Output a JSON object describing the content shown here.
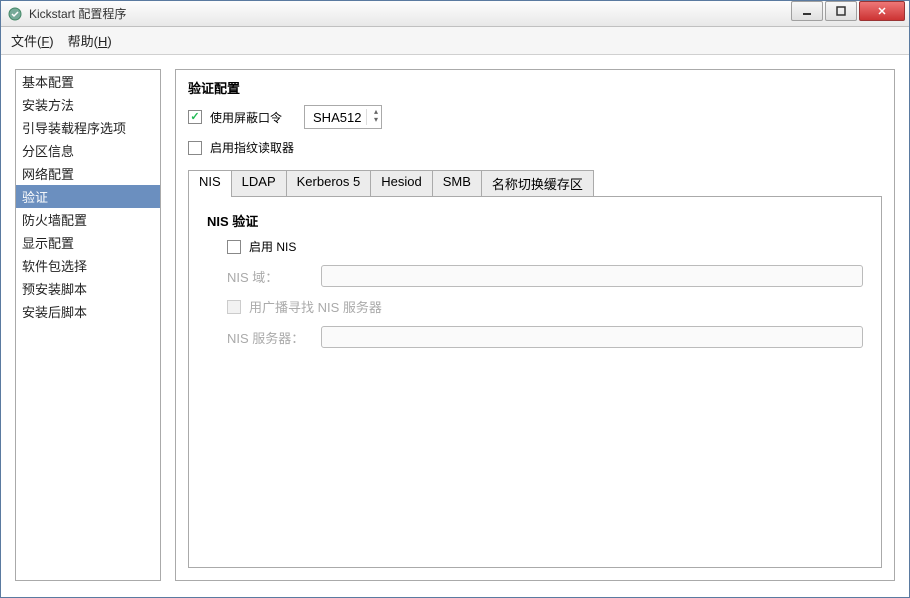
{
  "title": "Kickstart 配置程序",
  "menu": {
    "file": "文件(F)",
    "help": "帮助(H)"
  },
  "sidebar": {
    "items": [
      "基本配置",
      "安装方法",
      "引导装载程序选项",
      "分区信息",
      "网络配置",
      "验证",
      "防火墙配置",
      "显示配置",
      "软件包选择",
      "预安装脚本",
      "安装后脚本"
    ],
    "selected_index": 5
  },
  "auth": {
    "heading": "验证配置",
    "shadow_label": "使用屏蔽口令",
    "shadow_checked": true,
    "hash_algo": "SHA512",
    "fingerprint_label": "启用指纹读取器",
    "fingerprint_checked": false
  },
  "tabs": {
    "items": [
      "NIS",
      "LDAP",
      "Kerberos 5",
      "Hesiod",
      "SMB",
      "名称切换缓存区"
    ],
    "active_index": 0
  },
  "nis": {
    "title": "NIS 验证",
    "enable_label": "启用 NIS",
    "enable_checked": false,
    "domain_label": "NIS 域：",
    "broadcast_label": "用广播寻找 NIS 服务器",
    "server_label": "NIS 服务器："
  }
}
